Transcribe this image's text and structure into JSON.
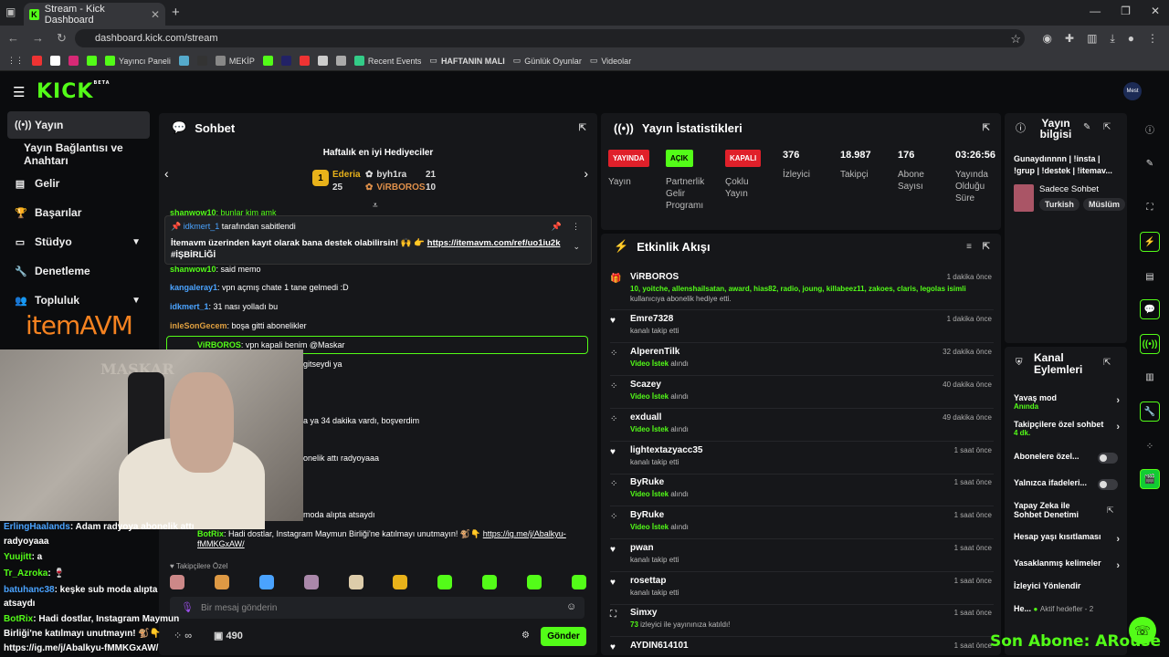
{
  "browser": {
    "tab_title": "Stream - Kick Dashboard",
    "url": "dashboard.kick.com/stream",
    "bookmarks": [
      "Yayıncı Paneli",
      "MEKİP",
      "Recent Events",
      "HAFTANIN MALI",
      "Günlük Oyunlar",
      "Videolar"
    ]
  },
  "kick": {
    "logo": "KICK",
    "beta": "BETA",
    "avatar_text": "Mest"
  },
  "sidebar": {
    "items": [
      {
        "label": "Yayın",
        "icon": "broadcast-icon"
      },
      {
        "label": "Yayın Bağlantısı ve Anahtarı",
        "icon": ""
      },
      {
        "label": "Gelir",
        "icon": "dollar-icon"
      },
      {
        "label": "Başarılar",
        "icon": "trophy-icon"
      },
      {
        "label": "Stüdyo",
        "icon": "studio-icon"
      },
      {
        "label": "Denetleme",
        "icon": "wrench-icon"
      },
      {
        "label": "Topluluk",
        "icon": "users-icon"
      }
    ]
  },
  "chat": {
    "title": "Sohbet",
    "gifters_title": "Haftalık en iyi Hediyeciler",
    "gifter1": {
      "name": "Ederia",
      "count": "25"
    },
    "gifter2": {
      "name": "byh1ra",
      "count": "21"
    },
    "gifter3": {
      "name": "ViRBOROS",
      "count": "10"
    },
    "pinned_by": "idkmert_1",
    "pinned_suffix": "tarafından sabitlendi",
    "pinned_text": "İtemavm üzerinden kayıt olarak bana destek olabilirsin! 🙌 👉",
    "pinned_link": "https://itemavm.com/ref/uo1iu2k",
    "pinned_tag": "#İŞBİRLİĞİ",
    "messages": [
      {
        "user": "shanwow10",
        "text": ": bunlar kim amk"
      },
      {
        "user": "shanwow10",
        "text": ": said memo"
      },
      {
        "user": "kangaleray1",
        "text": ": vpn açmış chate 1 tane gelmedi :D"
      },
      {
        "user": "idkmert_1",
        "text": ": 31 nası yolladı bu"
      },
      {
        "user": "inleSonGecem",
        "text": ": boşa gitti abonelikler"
      },
      {
        "user": "ViRBOROS",
        "text": ": vpn kapali benim @Maskar"
      },
      {
        "user": "",
        "text": "gitseydi ya"
      },
      {
        "user": "",
        "text": "a ya 34 dakika vardı, boşverdim"
      },
      {
        "user": "",
        "text": "onelik attı radyoyaaa"
      },
      {
        "user": "",
        "text": "moda alıpta atsaydı"
      }
    ],
    "botrix": {
      "user": "BotRix",
      "text": ": Hadi dostlar, Instagram Maymun Birliği'ne katılmayı unutmayın! 🐒👇",
      "link": "https://ig.me/j/Abalkyu-fMMKGxAW/"
    },
    "followers_only": "Takipçilere Özel",
    "input_placeholder": "Bir mesaj gönderin",
    "points": "490",
    "send": "Gönder"
  },
  "stats": {
    "title": "Yayın İstatistikleri",
    "items": [
      {
        "value": "YAYINDA",
        "label": "Yayın"
      },
      {
        "value": "AÇIK",
        "label": "Partnerlik Gelir Programı"
      },
      {
        "value": "KAPALI",
        "label": "Çoklu Yayın"
      },
      {
        "value": "376",
        "label": "İzleyici"
      },
      {
        "value": "18.987",
        "label": "Takipçi"
      },
      {
        "value": "176",
        "label": "Abone Sayısı"
      },
      {
        "value": "03:26:56",
        "label": "Yayında Olduğu Süre"
      }
    ]
  },
  "activity": {
    "title": "Etkinlik Akışı",
    "items": [
      {
        "name": "ViRBOROS",
        "sub": "10, yoitche, allenshailsatan, award, hias82, radio, joung, killabeez11, zakoes, claris, legolas isimli",
        "sub2": "kullanıcıya abonelik hediye etti.",
        "time": "1 dakika önce"
      },
      {
        "name": "Emre7328",
        "sub": "kanalı takip etti",
        "time": "1 dakika önce"
      },
      {
        "name": "AlperenTilk",
        "hl": "Video İstek",
        "sub": "alındı",
        "time": "32 dakika önce"
      },
      {
        "name": "Scazey",
        "hl": "Video İstek",
        "sub": "alındı",
        "time": "40 dakika önce"
      },
      {
        "name": "exduall",
        "hl": "Video İstek",
        "sub": "alındı",
        "time": "49 dakika önce"
      },
      {
        "name": "lightextazyacc35",
        "sub": "kanalı takip etti",
        "time": "1 saat önce"
      },
      {
        "name": "ByRuke",
        "hl": "Video İstek",
        "sub": "alındı",
        "time": "1 saat önce"
      },
      {
        "name": "ByRuke",
        "hl": "Video İstek",
        "sub": "alındı",
        "time": "1 saat önce"
      },
      {
        "name": "pwan",
        "sub": "kanalı takip etti",
        "time": "1 saat önce"
      },
      {
        "name": "rosettap",
        "sub": "kanalı takip etti",
        "time": "1 saat önce"
      },
      {
        "name": "Simxy",
        "hl": "73",
        "sub": "izleyici ile yayınınıza katıldı!",
        "time": "1 saat önce"
      },
      {
        "name": "AYDIN614101",
        "sub": "",
        "time": "1 saat önce"
      }
    ]
  },
  "stream_info": {
    "title": "Yayın bilgisi",
    "stream_title": "Gunaydınnnn | !insta | !grup | !destek | !itemav...",
    "category": "Sadece Sohbet",
    "tags": [
      "Turkish",
      "Müslüm"
    ]
  },
  "channel_actions": {
    "title": "Kanal Eylemleri",
    "slow_mode": "Yavaş mod",
    "slow_mode_status": "Anında",
    "followers_chat": "Takipçilere özel sohbet",
    "followers_chat_status": "4 dk.",
    "subscribers": "Abonelere özel...",
    "emotes": "Yalnızca ifadeleri...",
    "ai": "Yapay Zeka ile Sohbet Denetimi",
    "age": "Hesap yaşı kısıtlaması",
    "banned_words": "Yasaklanmış kelimeler",
    "viewer_redirect": "İzleyici Yönlendir",
    "he": "He...",
    "he_status": "Aktif hedefler - 2"
  },
  "overlay": {
    "brand": "itemAVM",
    "cam_text": "MASKAR",
    "son_abone": "Son Abone: ARouse",
    "chat": [
      {
        "user": "ErlingHaalands",
        "text": ": Adam radyoya abonelik attı"
      },
      {
        "user": "",
        "text": "radyoyaaa"
      },
      {
        "user": "Yuujitt",
        "text": ": a"
      },
      {
        "user": "Tr_Azroka",
        "text": ": 🍷"
      },
      {
        "user": "batuhanc38",
        "text": ": keşke sub moda alıpta"
      },
      {
        "user": "",
        "text": "atsaydı"
      },
      {
        "user": "BotRix",
        "text": ": Hadi dostlar, Instagram Maymun"
      },
      {
        "user": "",
        "text": "Birliği'ne katılmayı unutmayın! 🐒👇"
      },
      {
        "user": "",
        "text": "https://ig.me/j/Abalkyu-fMMKGxAW/"
      }
    ]
  }
}
